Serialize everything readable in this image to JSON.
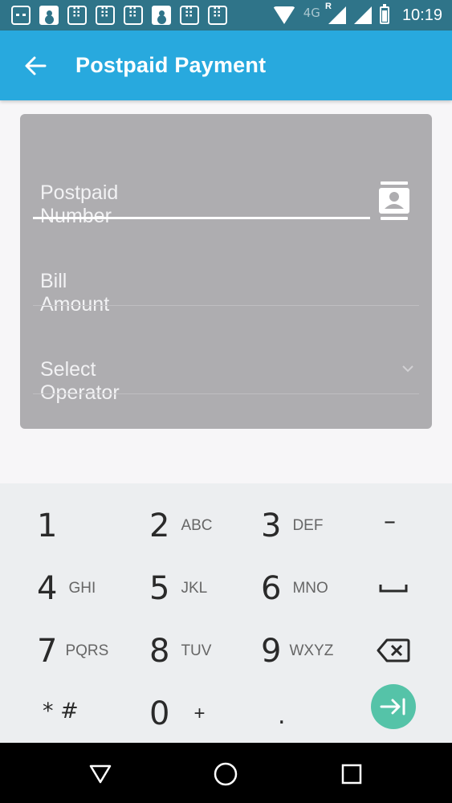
{
  "status_bar": {
    "left_icons": [
      "message-icon",
      "contact-card-icon",
      "sim-grid-icon",
      "sim-grid-icon",
      "sim-grid-icon",
      "chat-icon",
      "sim-grid-icon",
      "sim-grid-icon"
    ],
    "network_label": "4G",
    "roaming_label": "R",
    "time": "10:19"
  },
  "app_bar": {
    "back_icon": "arrow-left-icon",
    "title": "Postpaid Payment",
    "background": "#28a9de"
  },
  "form": {
    "postpaid_number": {
      "placeholder": "Postpaid Number",
      "value": ""
    },
    "contact_picker_icon": "contact-book-icon",
    "bill_amount": {
      "placeholder": "Bill Amount",
      "value": ""
    },
    "operator": {
      "placeholder": "Select Operator",
      "icon": "chevron-down-icon"
    }
  },
  "keypad": {
    "keys": [
      {
        "digit": "1",
        "letters": ""
      },
      {
        "digit": "2",
        "letters": "ABC"
      },
      {
        "digit": "3",
        "letters": "DEF"
      },
      {
        "digit": "–",
        "letters": ""
      },
      {
        "digit": "4",
        "letters": "GHI"
      },
      {
        "digit": "5",
        "letters": "JKL"
      },
      {
        "digit": "6",
        "letters": "MNO"
      },
      {
        "digit": "",
        "letters": "",
        "icon": "space-icon"
      },
      {
        "digit": "7",
        "letters": "PQRS"
      },
      {
        "digit": "8",
        "letters": "TUV"
      },
      {
        "digit": "9",
        "letters": "WXYZ"
      },
      {
        "digit": "",
        "letters": "",
        "icon": "backspace-icon"
      },
      {
        "digit": "* #",
        "letters": ""
      },
      {
        "digit": "0",
        "letters": "+"
      },
      {
        "digit": ".",
        "letters": ""
      }
    ],
    "next_icon": "next-field-icon",
    "accent": "#55c3a8"
  },
  "nav_bar": {
    "icons": [
      "nav-back-icon",
      "nav-home-icon",
      "nav-recents-icon"
    ]
  }
}
